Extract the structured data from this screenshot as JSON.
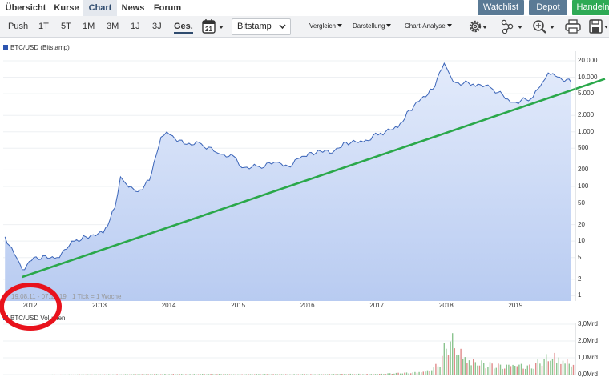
{
  "nav": {
    "tabs": [
      {
        "label": "Übersicht"
      },
      {
        "label": "Kurse"
      },
      {
        "label": "Chart"
      },
      {
        "label": "News"
      },
      {
        "label": "Forum"
      }
    ],
    "buttons": [
      {
        "label": "Watchlist",
        "color": "#5a7a95"
      },
      {
        "label": "Depot",
        "color": "#5a7a95"
      },
      {
        "label": "Handeln",
        "color": "#2eaa55"
      }
    ]
  },
  "toolbar": {
    "timeframes": [
      "Push",
      "1T",
      "5T",
      "1M",
      "3M",
      "1J",
      "3J",
      "Ges."
    ],
    "active_timeframe": "Ges.",
    "calendar_day": "21",
    "exchange": "Bitstamp",
    "menus": [
      "Vergleich",
      "Darstellung",
      "Chart-Analyse"
    ],
    "icons": [
      "settings-gear-icon",
      "share-nodes-icon",
      "zoom-in-icon",
      "print-icon",
      "save-icon"
    ]
  },
  "chart": {
    "series_label": "BTC/USD (Bitstamp)",
    "volume_label": "BTC/USD Volumen",
    "date_range_info": "19.08.11 - 07.10.19",
    "tick_info": "1 Tick = 1 Woche",
    "colors": {
      "price_line": "#3a64b8",
      "price_fill": "#c7d6f5",
      "trend_line": "#2aa84a",
      "volume_up": "#8bc48f",
      "volume_down": "#e08a8a",
      "annotation": "#e8121c"
    }
  },
  "chart_data": [
    {
      "type": "area",
      "title": "BTC/USD (Bitstamp)",
      "scale": "log",
      "x_tick_labels": [
        "2012",
        "2013",
        "2014",
        "2015",
        "2016",
        "2017",
        "2018",
        "2019"
      ],
      "y_tick_labels": [
        "20.000",
        "10.000",
        "5.000",
        "2.000",
        "1.000",
        "500",
        "200",
        "100",
        "50",
        "20",
        "10",
        "5",
        "2",
        "1"
      ],
      "ylim": [
        0.8,
        30000
      ],
      "x": [
        "2011-08",
        "2011-10",
        "2011-11",
        "2012-01",
        "2012-05",
        "2012-08",
        "2012-10",
        "2013-01",
        "2013-03",
        "2013-04",
        "2013-05",
        "2013-07",
        "2013-09",
        "2013-11",
        "2013-12",
        "2014-01",
        "2014-03",
        "2014-06",
        "2014-09",
        "2014-12",
        "2015-01",
        "2015-04",
        "2015-07",
        "2015-09",
        "2015-11",
        "2016-01",
        "2016-05",
        "2016-07",
        "2016-10",
        "2017-01",
        "2017-04",
        "2017-06",
        "2017-08",
        "2017-10",
        "2017-12",
        "2018-01",
        "2018-02",
        "2018-05",
        "2018-08",
        "2018-11",
        "2018-12",
        "2019-03",
        "2019-05",
        "2019-06",
        "2019-08",
        "2019-10"
      ],
      "values": [
        12,
        5,
        3,
        5,
        5,
        10,
        12,
        14,
        40,
        150,
        110,
        80,
        130,
        800,
        1000,
        850,
        600,
        600,
        400,
        330,
        220,
        230,
        280,
        235,
        330,
        420,
        450,
        650,
        650,
        950,
        1200,
        2500,
        4000,
        6000,
        18000,
        11000,
        8000,
        7500,
        6500,
        4000,
        3500,
        4000,
        8000,
        12000,
        10000,
        8000
      ],
      "trend_line": {
        "label": "",
        "start": {
          "x": "2011-11",
          "y": 2.2
        },
        "end": {
          "x": "2019-10",
          "y": 10000
        }
      },
      "annotation": "red circle around the 2012 axis label"
    },
    {
      "type": "bar",
      "title": "BTC/USD Volumen",
      "y_tick_labels": [
        "3,0Mrd",
        "2,0Mrd",
        "1,0Mrd",
        "0,0Mrd"
      ],
      "ylim": [
        0,
        3.0
      ],
      "unit": "Mrd",
      "x": [
        "2011",
        "2012",
        "2013",
        "2014",
        "2015",
        "2016",
        "2017",
        "2017-06",
        "2017-09",
        "2017-11",
        "2017-12",
        "2018-01",
        "2018-02",
        "2018-04",
        "2018-07",
        "2018-10",
        "2018-12",
        "2019-03",
        "2019-05",
        "2019-07",
        "2019-10"
      ],
      "values": [
        0.0,
        0.0,
        0.02,
        0.05,
        0.04,
        0.04,
        0.06,
        0.15,
        0.3,
        0.8,
        2.0,
        2.8,
        2.2,
        1.3,
        0.8,
        0.7,
        0.9,
        0.6,
        1.2,
        1.6,
        0.9
      ]
    }
  ]
}
